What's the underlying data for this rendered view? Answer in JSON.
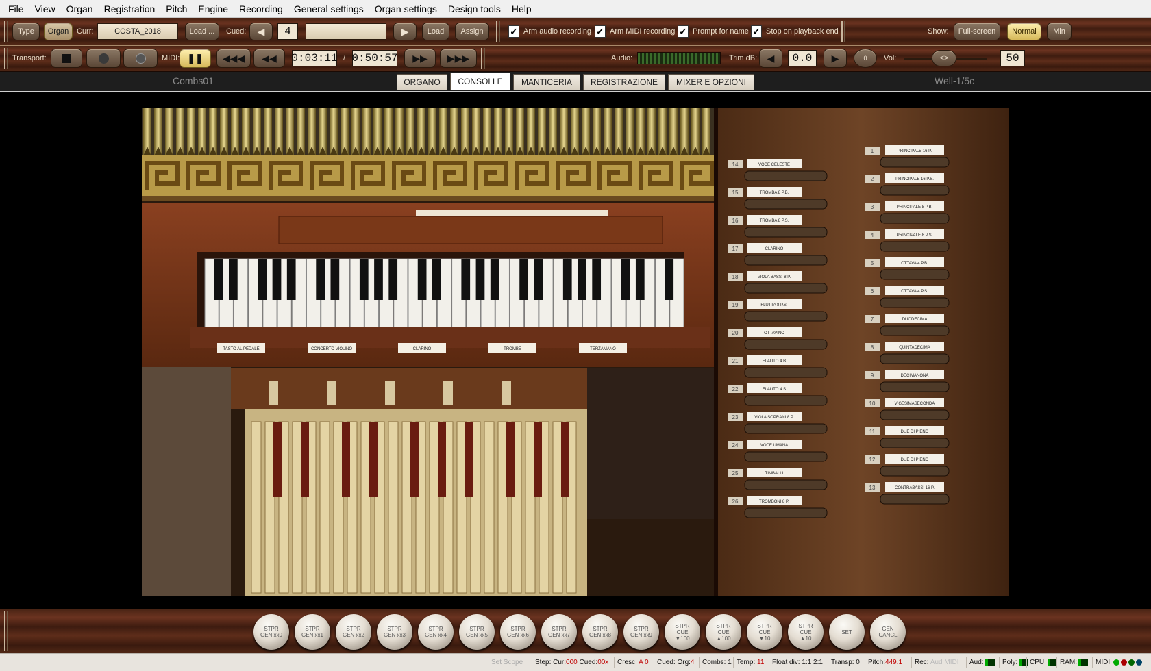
{
  "menu": [
    "File",
    "View",
    "Organ",
    "Registration",
    "Pitch",
    "Engine",
    "Recording",
    "General settings",
    "Organ settings",
    "Design tools",
    "Help"
  ],
  "toolbar1": {
    "type_label": "Type",
    "organ_label": "Organ",
    "curr_label": "Curr:",
    "curr_value": "COSTA_2018",
    "load_dots_label": "Load ...",
    "cued_label": "Cued:",
    "cued_value": "4",
    "cued_name": "",
    "load_label": "Load",
    "assign_label": "Assign",
    "arm_audio_label": "Arm audio recording",
    "arm_audio_checked": true,
    "arm_midi_label": "Arm MIDI recording",
    "arm_midi_checked": true,
    "prompt_label": "Prompt for name",
    "prompt_checked": true,
    "stop_label": "Stop on playback end",
    "stop_checked": true,
    "show_label": "Show:",
    "fullscreen_label": "Full-screen",
    "normal_label": "Normal",
    "min_label": "Min"
  },
  "toolbar2": {
    "transport_label": "Transport:",
    "midi_label": "MIDI:",
    "time_current": "0:03:11",
    "time_sep": "/",
    "time_total": "0:50:57",
    "audio_label": "Audio:",
    "trim_label": "Trim dB:",
    "trim_value": "0.0",
    "zero_label": "0",
    "vol_label": "Vol:",
    "vol_value": "50"
  },
  "tabs": {
    "left_title": "Combs01",
    "right_title": "Well-1/5c",
    "items": [
      "ORGANO",
      "CONSOLLE",
      "MANTICERIA",
      "REGISTRAZIONE",
      "MIXER E OPZIONI"
    ],
    "active": "CONSOLLE"
  },
  "organ": {
    "keyboard_labels": [
      "TASTO AL PEDALE",
      "CONCERTO VIOLINO",
      "CLARINO",
      "TROMBE",
      "TERZAMANO"
    ],
    "left_stops": [
      {
        "num": "14",
        "name": "VOCE CELESTE"
      },
      {
        "num": "15",
        "name": "TROMBA 8 P.B."
      },
      {
        "num": "16",
        "name": "TROMBA 8 P.S."
      },
      {
        "num": "17",
        "name": "CLARINO"
      },
      {
        "num": "18",
        "name": "VIOLA BASSI 8 P."
      },
      {
        "num": "19",
        "name": "FLUTTA 8 P.S."
      },
      {
        "num": "20",
        "name": "OTTAVINO"
      },
      {
        "num": "21",
        "name": "FLAUTO 4 B"
      },
      {
        "num": "22",
        "name": "FLAUTO 4 S"
      },
      {
        "num": "23",
        "name": "VIOLA SOPRANI 8 P."
      },
      {
        "num": "24",
        "name": "VOCE UMANA"
      },
      {
        "num": "25",
        "name": "TIMBALLI"
      },
      {
        "num": "26",
        "name": "TROMBONI 8 P."
      }
    ],
    "right_stops": [
      {
        "num": "1",
        "name": "PRINCIPALE 16 P."
      },
      {
        "num": "2",
        "name": "PRINCIPALE 16 P.S."
      },
      {
        "num": "3",
        "name": "PRINCIPALE 8 P.B."
      },
      {
        "num": "4",
        "name": "PRINCIPALE 8 P.S."
      },
      {
        "num": "5",
        "name": "OTTAVA 4 P.B."
      },
      {
        "num": "6",
        "name": "OTTAVA 4 P.S."
      },
      {
        "num": "7",
        "name": "DUODECIMA"
      },
      {
        "num": "8",
        "name": "QUINTADECIMA"
      },
      {
        "num": "9",
        "name": "DECIMANONA"
      },
      {
        "num": "10",
        "name": "VIGESIMASECONDA"
      },
      {
        "num": "11",
        "name": "DUE DI PIENO"
      },
      {
        "num": "12",
        "name": "DUE DI PIENO"
      },
      {
        "num": "13",
        "name": "CONTRABASSI 16 P."
      }
    ]
  },
  "pistons": [
    {
      "l1": "STPR",
      "l2": "GEN xx0"
    },
    {
      "l1": "STPR",
      "l2": "GEN xx1"
    },
    {
      "l1": "STPR",
      "l2": "GEN xx2"
    },
    {
      "l1": "STPR",
      "l2": "GEN xx3"
    },
    {
      "l1": "STPR",
      "l2": "GEN xx4"
    },
    {
      "l1": "STPR",
      "l2": "GEN xx5"
    },
    {
      "l1": "STPR",
      "l2": "GEN xx6"
    },
    {
      "l1": "STPR",
      "l2": "GEN xx7"
    },
    {
      "l1": "STPR",
      "l2": "GEN xx8"
    },
    {
      "l1": "STPR",
      "l2": "GEN xx9"
    },
    {
      "l1": "STPR",
      "l2": "CUE",
      "l3": "▼100"
    },
    {
      "l1": "STPR",
      "l2": "CUE",
      "l3": "▲100"
    },
    {
      "l1": "STPR",
      "l2": "CUE",
      "l3": "▼10"
    },
    {
      "l1": "STPR",
      "l2": "CUE",
      "l3": "▲10"
    },
    {
      "l1": "SET",
      "l2": ""
    },
    {
      "l1": "GEN",
      "l2": "CANCL"
    }
  ],
  "status": {
    "set_scope": "Set Scope",
    "step": "Step: Cur:",
    "step_cur": "000",
    "step_cued_label": "Cued:",
    "step_cued": "00x",
    "cresc_label": "Cresc:",
    "cresc": "A 0",
    "cued_org_label": "Cued: Org:",
    "cued_org": "4",
    "combs": "Combs: 1",
    "temp_label": "Temp:",
    "temp": "11",
    "float": "Float div: 1:1 2:1",
    "transp": "Transp: 0",
    "pitch_label": "Pitch:",
    "pitch": "449.1",
    "rec": "Rec:",
    "rec_aud": "Aud",
    "rec_midi": "MIDI",
    "aud": "Aud:",
    "poly": "Poly:",
    "cpu": "CPU:",
    "ram": "RAM:",
    "midi": "MIDI:"
  },
  "colors": {
    "wood": "#4a2414",
    "piston_text": "#555555",
    "status_red": "#c00000",
    "lit_button": "#f0d070"
  },
  "icons": [
    "stop-icon",
    "record-icon",
    "record-dim-icon",
    "pause-icon",
    "skip-back-icon",
    "rewind-icon",
    "fast-forward-icon",
    "skip-forward-icon",
    "prev-icon",
    "next-icon"
  ]
}
